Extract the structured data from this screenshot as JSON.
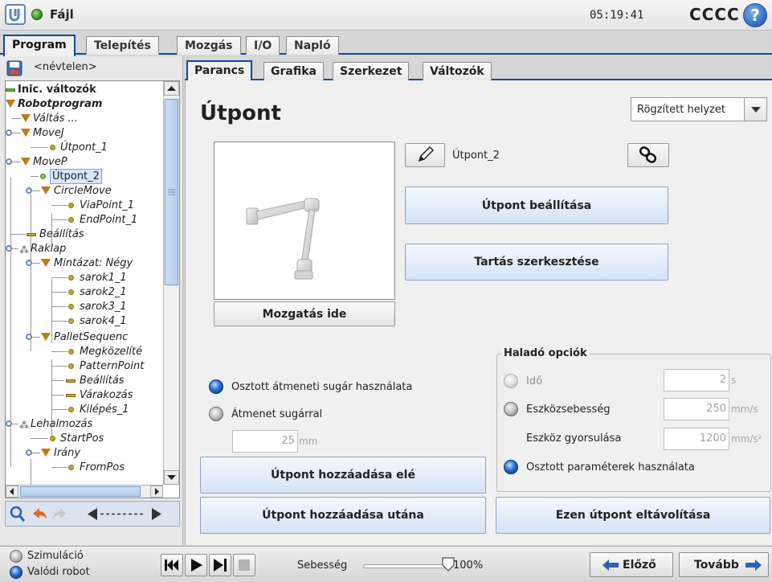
{
  "titlebar": {
    "file_menu": "Fájl",
    "clock": "05:19:41",
    "robot_name": "CCCC",
    "help": "?"
  },
  "main_tabs": [
    "Program",
    "Telepítés",
    "Mozgás",
    "I/O",
    "Napló"
  ],
  "left": {
    "program_name": "<névtelen>",
    "tree": [
      "Inic. változók",
      "Robotprogram",
      "Váltás ...",
      "MoveJ",
      "Útpont_1",
      "MoveP",
      "Útpont_2",
      "CircleMove",
      "ViaPoint_1",
      "EndPoint_1",
      "Beállítás",
      "Raklap",
      "Mintázat: Négy",
      "sarok1_1",
      "sarok2_1",
      "sarok3_1",
      "sarok4_1",
      "PalletSequenc",
      "Megközelíté",
      "PatternPoint",
      "Beállítás",
      "Várakozás",
      "Kilépés_1",
      "Lehalmozás",
      "StartPos",
      "Irány",
      "FromPos"
    ]
  },
  "sub_tabs": [
    "Parancs",
    "Grafika",
    "Szerkezet",
    "Változók"
  ],
  "content": {
    "title": "Útpont",
    "position_type": "Rögzített helyzet",
    "waypoint_name": "Útpont_2",
    "set_waypoint": "Útpont beállítása",
    "edit_hold": "Tartás szerkesztése",
    "move_here": "Mozgatás ide",
    "blend_shared": "Osztott átmeneti sugár használata",
    "blend_radius": "Átmenet sugárral",
    "blend_value": "25",
    "blend_unit": "mm",
    "advanced": {
      "title": "Haladó opciók",
      "time_label": "Idő",
      "time_value": "2",
      "time_unit": "s",
      "tool_speed_label": "Eszközsebesség",
      "tool_speed_value": "250",
      "tool_speed_unit": "mm/s",
      "tool_accel_label": "Eszköz gyorsulása",
      "tool_accel_value": "1200",
      "tool_accel_unit": "mm/s²",
      "shared_params": "Osztott paraméterek használata"
    },
    "add_before": "Útpont hozzáadása elé",
    "add_after": "Útpont hozzáadása utána",
    "remove": "Ezen útpont eltávolítása"
  },
  "bottom": {
    "simulation": "Szimuláció",
    "real_robot": "Valódi robot",
    "speed_label": "Sebesség",
    "speed_value": "100%",
    "speed_fraction": 1.0,
    "prev": "Előző",
    "next": "Tovább"
  },
  "colors": {
    "accent_blue": "#0f4aa0",
    "button_blue": "#d4e3f6"
  }
}
